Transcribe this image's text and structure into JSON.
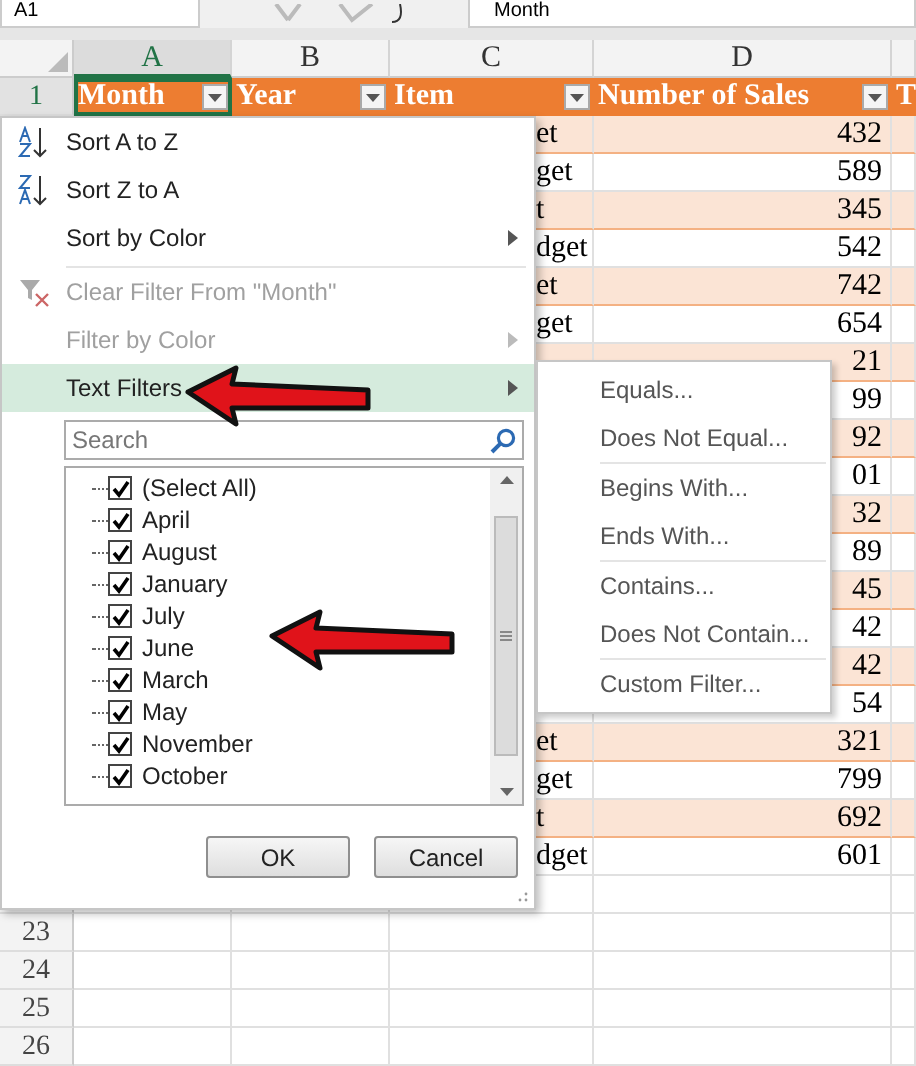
{
  "formula_bar": {
    "name_box": "A1",
    "formula": "Month"
  },
  "columns": [
    {
      "label": "A",
      "selected": true
    },
    {
      "label": "B",
      "selected": false
    },
    {
      "label": "C",
      "selected": false
    },
    {
      "label": "D",
      "selected": false
    }
  ],
  "header_row": {
    "number": "1",
    "cells": [
      {
        "text": "Month",
        "active": true,
        "filter": true
      },
      {
        "text": "Year",
        "active": false,
        "filter": true
      },
      {
        "text": "Item",
        "active": false,
        "filter": true
      },
      {
        "text": "Number of Sales",
        "active": false,
        "filter": true
      }
    ],
    "next_column_text": "T"
  },
  "data_rows": [
    {
      "item": "et",
      "sales": "432",
      "banded": true
    },
    {
      "item": "get",
      "sales": "589",
      "banded": false
    },
    {
      "item": "t",
      "sales": "345",
      "banded": true
    },
    {
      "item": "dget",
      "sales": "542",
      "banded": false
    },
    {
      "item": "et",
      "sales": "742",
      "banded": true
    },
    {
      "item": "get",
      "sales": "654",
      "banded": false
    },
    {
      "sales": "21",
      "banded": true
    },
    {
      "sales": "99",
      "banded": false
    },
    {
      "sales": "92",
      "banded": true
    },
    {
      "sales": "01",
      "banded": false
    },
    {
      "sales": "32",
      "banded": true
    },
    {
      "sales": "89",
      "banded": false
    },
    {
      "sales": "45",
      "banded": true
    },
    {
      "sales": "42",
      "banded": false
    },
    {
      "sales": "42",
      "banded": true
    },
    {
      "sales": "54",
      "banded": false
    },
    {
      "item": "et",
      "sales": "321",
      "banded": true
    },
    {
      "item": "get",
      "sales": "799",
      "banded": false
    },
    {
      "item": "t",
      "sales": "692",
      "banded": true
    },
    {
      "item": "dget",
      "sales": "601",
      "banded": false
    },
    {
      "banded": false
    }
  ],
  "empty_rows": [
    "23",
    "24",
    "25",
    "26"
  ],
  "filter_menu": {
    "items": [
      {
        "kind": "sort-asc",
        "label": "Sort A to Z",
        "disabled": false,
        "submenu": false,
        "highlighted": false,
        "divider_after": false
      },
      {
        "kind": "sort-desc",
        "label": "Sort Z to A",
        "disabled": false,
        "submenu": false,
        "highlighted": false,
        "divider_after": false
      },
      {
        "kind": "plain",
        "label": "Sort by Color",
        "disabled": false,
        "submenu": true,
        "highlighted": false,
        "divider_after": true
      },
      {
        "kind": "clear",
        "label": "Clear Filter From \"Month\"",
        "disabled": true,
        "submenu": false,
        "highlighted": false,
        "divider_after": false
      },
      {
        "kind": "plain",
        "label": "Filter by Color",
        "disabled": true,
        "submenu": true,
        "highlighted": false,
        "divider_after": false
      },
      {
        "kind": "plain",
        "label": "Text Filters",
        "disabled": false,
        "submenu": true,
        "highlighted": true,
        "divider_after": false
      }
    ],
    "search": {
      "placeholder": "Search"
    },
    "values": [
      {
        "label": "(Select All)",
        "checked": true
      },
      {
        "label": "April",
        "checked": true
      },
      {
        "label": "August",
        "checked": true
      },
      {
        "label": "January",
        "checked": true
      },
      {
        "label": "July",
        "checked": true
      },
      {
        "label": "June",
        "checked": true
      },
      {
        "label": "March",
        "checked": true
      },
      {
        "label": "May",
        "checked": true
      },
      {
        "label": "November",
        "checked": true
      },
      {
        "label": "October",
        "checked": true
      }
    ],
    "buttons": [
      "OK",
      "Cancel"
    ]
  },
  "text_filters_submenu": {
    "groups": [
      [
        "Equals...",
        "Does Not Equal..."
      ],
      [
        "Begins With...",
        "Ends With..."
      ],
      [
        "Contains...",
        "Does Not Contain..."
      ],
      [
        "Custom Filter..."
      ]
    ]
  }
}
